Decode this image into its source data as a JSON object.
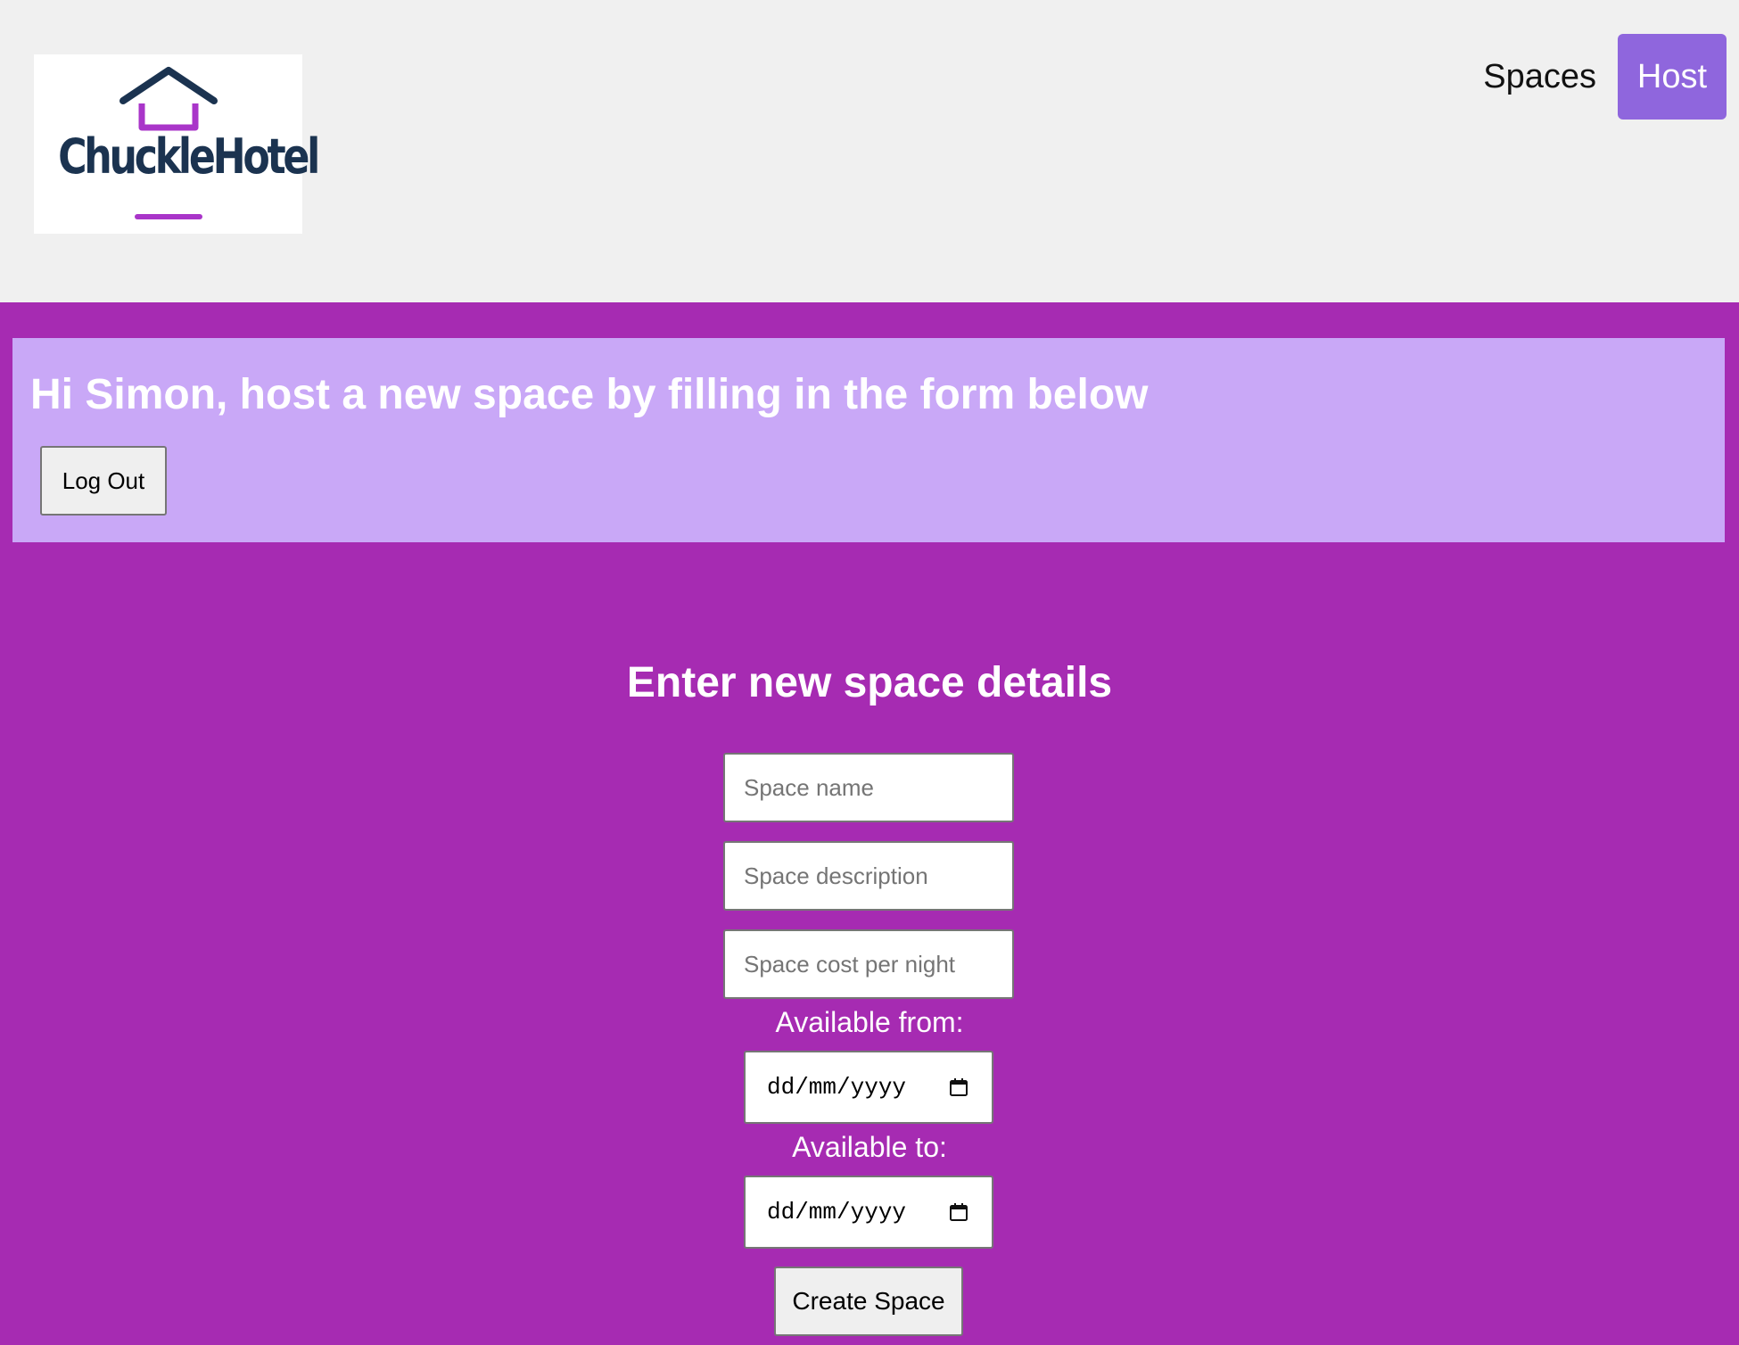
{
  "header": {
    "logo_text": "ChuckleHotel",
    "nav": {
      "spaces_label": "Spaces",
      "host_label": "Host"
    }
  },
  "welcome": {
    "title": "Hi Simon, host a new space by filling in the form below",
    "logout_label": "Log Out"
  },
  "form": {
    "title": "Enter new space details",
    "name_placeholder": "Space name",
    "description_placeholder": "Space description",
    "cost_placeholder": "Space cost per night",
    "available_from_label": "Available from:",
    "available_from_value": "dd/mm/yyyy",
    "available_to_label": "Available to:",
    "available_to_value": "dd/mm/yyyy",
    "submit_label": "Create Space"
  },
  "colors": {
    "page_background": "#a62bb2",
    "header_background": "#f0f0f0",
    "welcome_background": "#c9a8f7",
    "host_button": "#8f66dd",
    "logo_text": "#1b3350",
    "logo_accent": "#a935c9"
  },
  "icons": {
    "logo": "house-logo-icon",
    "date_picker": "calendar-icon"
  }
}
